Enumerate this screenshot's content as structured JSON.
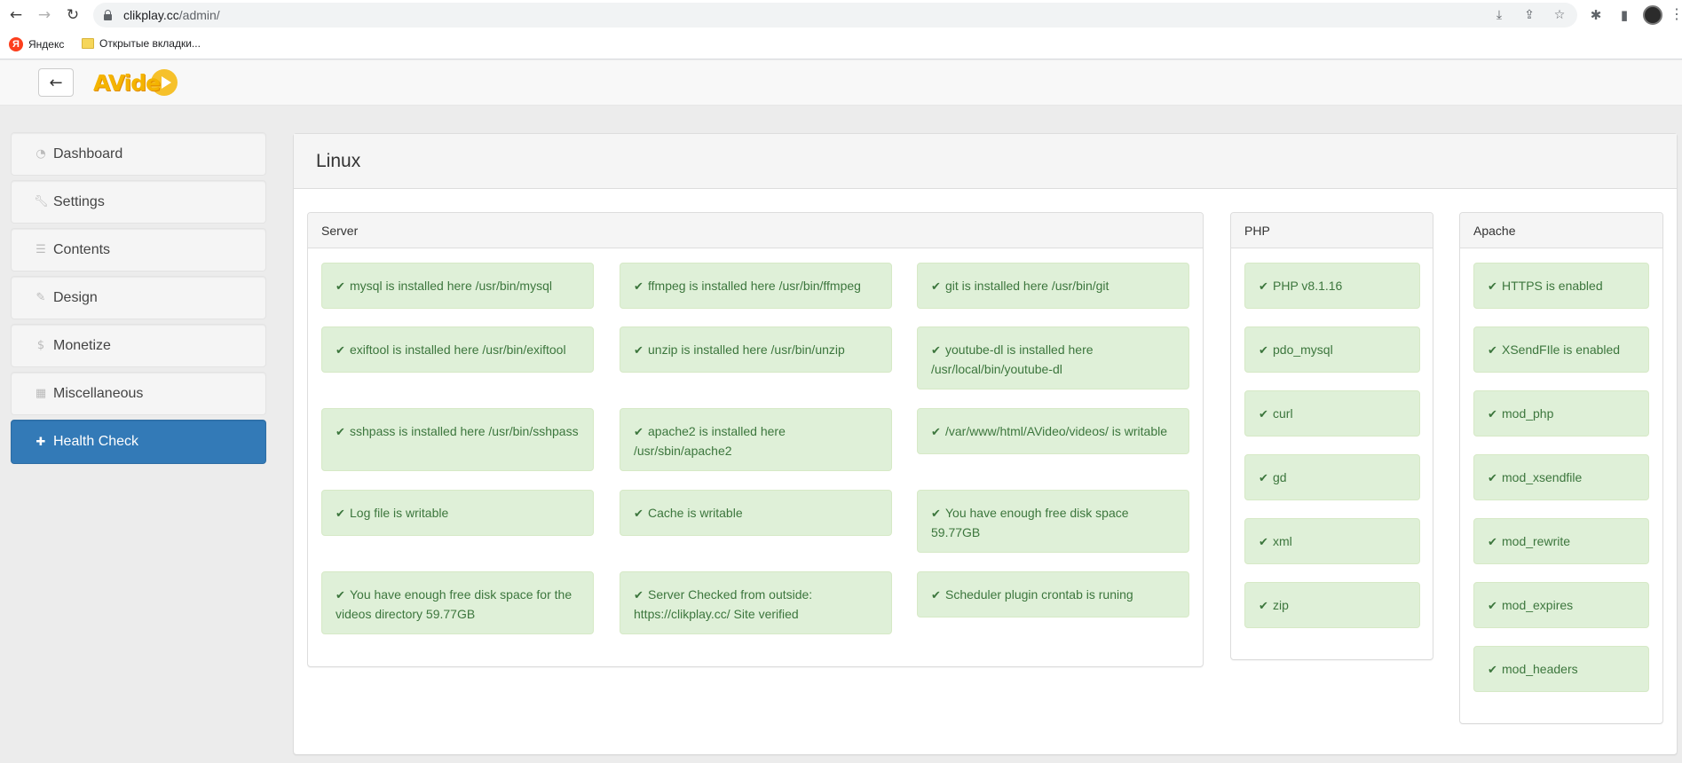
{
  "browser": {
    "url_host": "clikplay.cc",
    "url_path": "/admin/",
    "bookmarks": [
      {
        "label": "Яндекс"
      },
      {
        "label": "Открытые вкладки..."
      }
    ]
  },
  "header": {
    "back_label": "←",
    "logo_text": "AVide"
  },
  "sidebar": {
    "items": [
      {
        "label": "Dashboard",
        "icon": "dashboard-icon"
      },
      {
        "label": "Settings",
        "icon": "wrench-icon"
      },
      {
        "label": "Contents",
        "icon": "list-icon"
      },
      {
        "label": "Design",
        "icon": "brush-icon"
      },
      {
        "label": "Monetize",
        "icon": "dollar-icon"
      },
      {
        "label": "Miscellaneous",
        "icon": "grid-icon"
      },
      {
        "label": "Health Check",
        "icon": "medkit-icon",
        "active": true
      }
    ]
  },
  "main": {
    "title": "Linux",
    "server": {
      "title": "Server",
      "items": [
        "mysql is installed here /usr/bin/mysql",
        "ffmpeg is installed here /usr/bin/ffmpeg",
        "git is installed here /usr/bin/git",
        "exiftool is installed here /usr/bin/exiftool",
        "unzip is installed here /usr/bin/unzip",
        "youtube-dl is installed here /usr/local/bin/youtube-dl",
        "sshpass is installed here /usr/bin/sshpass",
        "apache2 is installed here /usr/sbin/apache2",
        "/var/www/html/AVideo/videos/ is writable",
        "Log file is writable",
        "Cache is writable",
        "You have enough free disk space 59.77GB",
        "You have enough free disk space for the videos directory 59.77GB",
        "Server Checked from outside: https://clikplay.cc/ Site verified",
        "Scheduler plugin crontab is runing"
      ]
    },
    "php": {
      "title": "PHP",
      "items": [
        "PHP v8.1.16",
        "pdo_mysql",
        "curl",
        "gd",
        "xml",
        "zip"
      ]
    },
    "apache": {
      "title": "Apache",
      "items": [
        "HTTPS is enabled",
        "XSendFIle is enabled",
        "mod_php",
        "mod_xsendfile",
        "mod_rewrite",
        "mod_expires",
        "mod_headers"
      ]
    },
    "check_glyph": "✔"
  },
  "colors": {
    "success_bg": "#dff0d8",
    "success_text": "#3c763d",
    "primary": "#337ab7"
  }
}
